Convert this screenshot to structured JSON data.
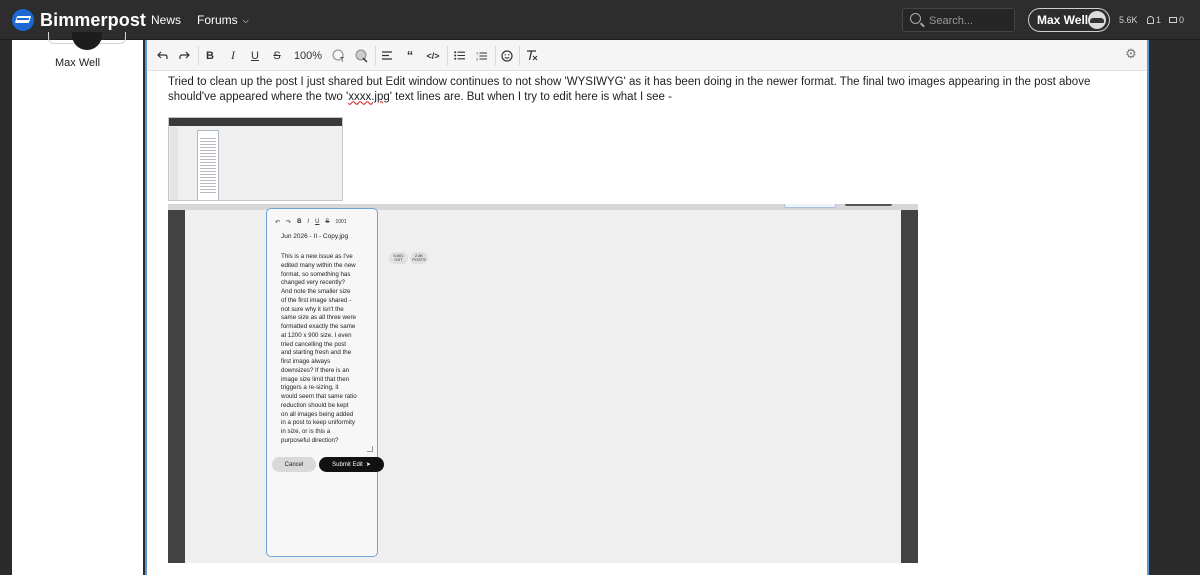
{
  "site": {
    "name": "Bimmerpost"
  },
  "nav": {
    "news": "News",
    "forums": "Forums"
  },
  "search": {
    "placeholder": "Search..."
  },
  "user": {
    "name": "Max Well"
  },
  "stats": {
    "posts": "5.6K",
    "notifications": "1",
    "messages": "0"
  },
  "author": {
    "name": "Max Well"
  },
  "toolbar": {
    "zoom": "100%",
    "items": [
      "undo",
      "redo",
      "bold",
      "italic",
      "underline",
      "strikethrough",
      "zoom",
      "text-color",
      "background-color",
      "align",
      "quote",
      "code",
      "bulleted-list",
      "numbered-list",
      "emoji",
      "clear-format",
      "settings"
    ]
  },
  "post": {
    "text_before": "Tried to clean up the post I just shared but Edit window continues to not show 'WYSIWYG' as it has been doing in the newer format. The final two images appearing in the post above should've appeared where the two '",
    "text_misspelled": "xxxx.jpg",
    "text_after": "' text lines are. But when I try to edit here is what I see -"
  },
  "embedded_screenshot": {
    "zoom": "1001",
    "filename": "Jun 2026 - II - Copy.jpg",
    "body_lines": [
      "This is a new issue as I've",
      "edited many within the new",
      "format, so something has",
      "changed very recently?",
      "And note the smaller size",
      "of the first image shared -",
      "not sure why it isn't the",
      "same size as all three were",
      "formatted exactly the same",
      "at 1200 x 900 size. I even",
      "tried cancelling the post",
      "and starting fresh and the",
      "first image always",
      "downsizes? If there is an",
      "image size limit that then",
      "triggers a re-sizing, it",
      "would seem that same ratio",
      "reduction should be kept",
      "on all images being added",
      "in a post to keep uniformity",
      "in size, or is this a",
      "purposeful direction?"
    ],
    "cancel": "Cancel",
    "submit": "Submit Edit",
    "stat1_value": "5,601",
    "stat1_label": "GST",
    "stat2_value": "2.8K",
    "stat2_label": "POSTS"
  },
  "colors": {
    "brand": "#1c69d4",
    "accent_border": "#5b9bd5",
    "topbar": "#2d2d2d"
  }
}
